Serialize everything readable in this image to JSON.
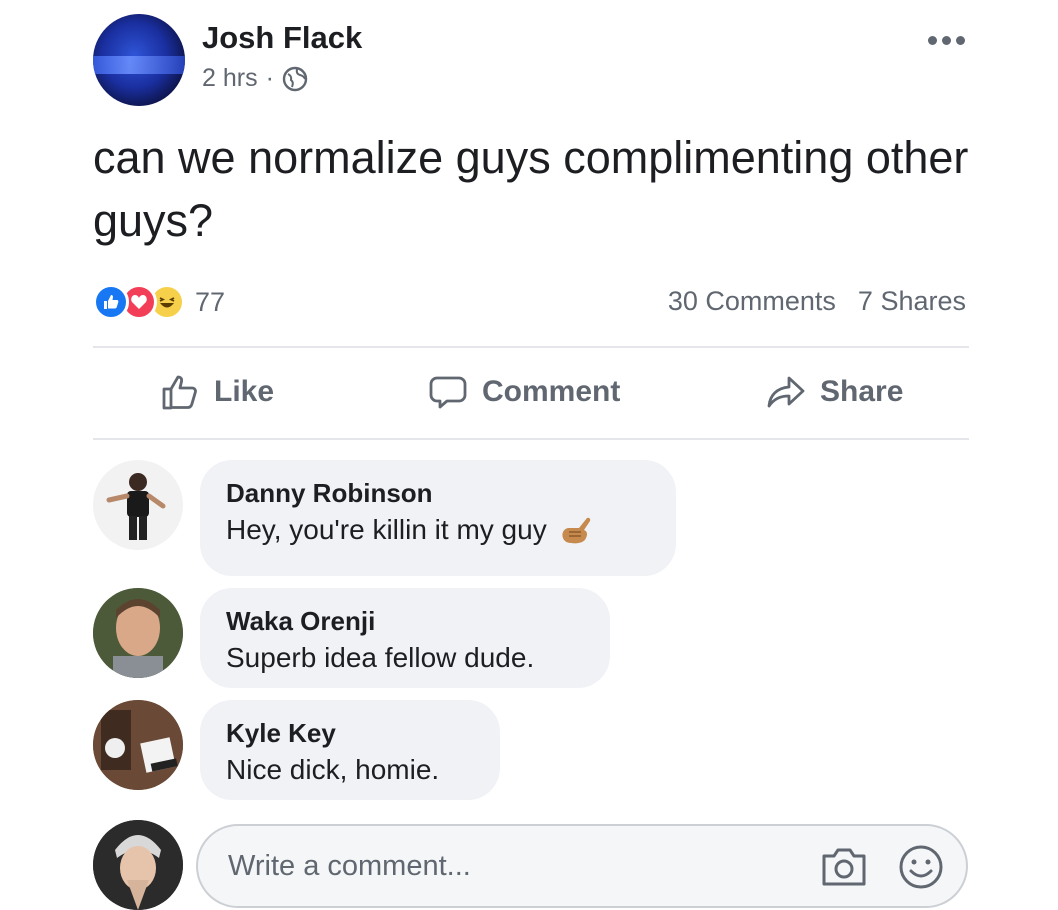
{
  "post": {
    "author": "Josh Flack",
    "time": "2 hrs",
    "separator": "·",
    "text": "can we normalize guys complimenting other guys?"
  },
  "stats": {
    "reaction_count": "77",
    "comments": "30 Comments",
    "shares": "7 Shares"
  },
  "actions": {
    "like": "Like",
    "comment": "Comment",
    "share": "Share"
  },
  "comments": [
    {
      "name": "Danny Robinson",
      "text": "Hey, you're killin it my guy",
      "emoji": "call-me-hand-icon"
    },
    {
      "name": "Waka Orenji",
      "text": "Superb idea fellow dude."
    },
    {
      "name": "Kyle Key",
      "text": "Nice dick, homie."
    }
  ],
  "composer": {
    "placeholder": "Write a comment..."
  },
  "colors": {
    "like_blue": "#1877f2",
    "love_red": "#f33e58",
    "haha_yellow": "#f7d04b",
    "secondary_text": "#606770",
    "bubble_bg": "#f0f2f5"
  }
}
